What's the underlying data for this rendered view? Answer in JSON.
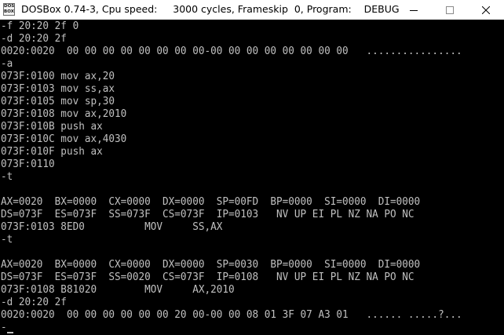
{
  "titlebar": {
    "icon_text": "DOS\nBOX",
    "title": "DOSBox 0.74-3, Cpu speed:     3000 cycles, Frameskip  0, Program:    DEBUG",
    "icons": {
      "app": "dosbox-icon",
      "minimize": "minimize-icon",
      "maximize": "maximize-icon",
      "close": "close-icon"
    }
  },
  "console": {
    "lines": [
      "-f 20:20 2f 0",
      "-d 20:20 2f",
      "0020:0020  00 00 00 00 00 00 00 00-00 00 00 00 00 00 00 00   ................",
      "-a",
      "073F:0100 mov ax,20",
      "073F:0103 mov ss,ax",
      "073F:0105 mov sp,30",
      "073F:0108 mov ax,2010",
      "073F:010B push ax",
      "073F:010C mov ax,4030",
      "073F:010F push ax",
      "073F:0110",
      "-t",
      "",
      "AX=0020  BX=0000  CX=0000  DX=0000  SP=00FD  BP=0000  SI=0000  DI=0000",
      "DS=073F  ES=073F  SS=073F  CS=073F  IP=0103   NV UP EI PL NZ NA PO NC",
      "073F:0103 8ED0          MOV     SS,AX",
      "-t",
      "",
      "AX=0020  BX=0000  CX=0000  DX=0000  SP=0030  BP=0000  SI=0000  DI=0000",
      "DS=073F  ES=073F  SS=0020  CS=073F  IP=0108   NV UP EI PL NZ NA PO NC",
      "073F:0108 B81020        MOV     AX,2010",
      "-d 20:20 2f",
      "0020:0020  00 00 00 00 00 00 20 00-00 00 08 01 3F 07 A3 01   ...... .....?...",
      "-"
    ]
  },
  "colors": {
    "console_bg": "#000000",
    "console_fg": "#c0c0c0",
    "titlebar_bg": "#ffffff"
  }
}
